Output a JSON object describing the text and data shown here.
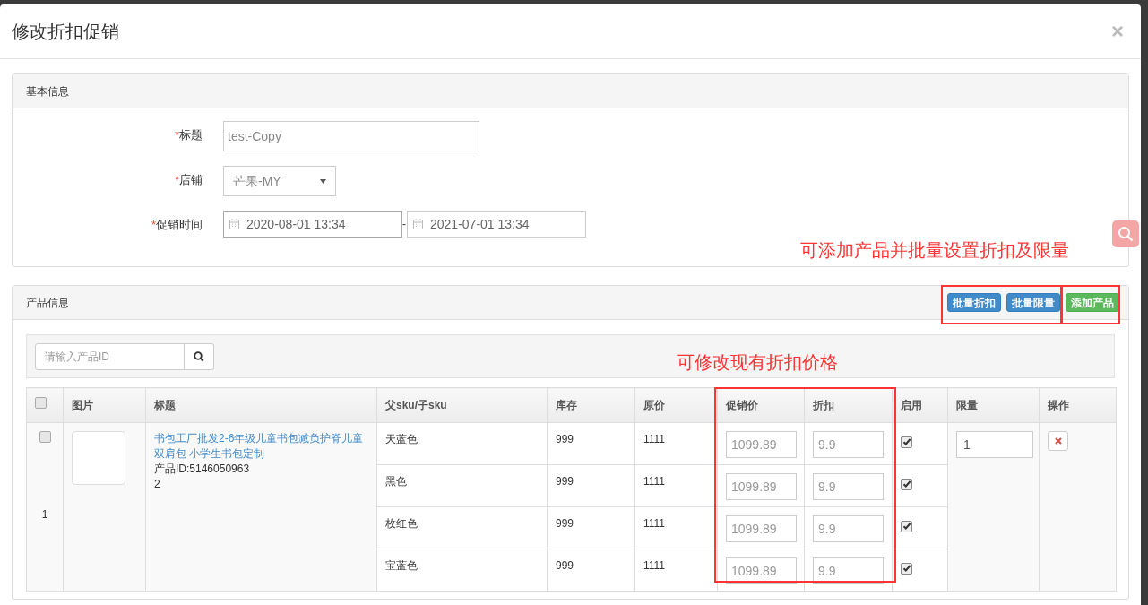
{
  "dialog": {
    "title": "修改折扣促销",
    "close": "×"
  },
  "basic_info": {
    "heading": "基本信息",
    "fields": [
      {
        "kind": "text",
        "required_mark": "*",
        "label": "标题",
        "value": "test-Copy"
      },
      {
        "kind": "select",
        "required_mark": "*",
        "label": "店铺",
        "value": "芒果-MY"
      },
      {
        "kind": "daterange",
        "required_mark": "*",
        "label": "促销时间",
        "start": "2020-08-01 13:34",
        "separator": "-",
        "end": "2021-07-01 13:34"
      }
    ]
  },
  "annotations": [
    "可添加产品并批量设置折扣及限量",
    "可修改现有折扣价格"
  ],
  "product_info": {
    "heading": "产品信息",
    "buttons": [
      {
        "label": "批量折扣",
        "kind": "primary"
      },
      {
        "label": "批量限量",
        "kind": "primary"
      },
      {
        "label": "添加产品",
        "kind": "success"
      }
    ],
    "search": {
      "placeholder": "请输入产品ID"
    },
    "table": {
      "select_all": {
        "checked": false
      },
      "columns": [
        "图片",
        "标题",
        "父sku/子sku",
        "库存",
        "原价",
        "促销价",
        "折扣",
        "启用",
        "限量",
        "操作"
      ],
      "rows": [
        {
          "index": "1",
          "checked": false,
          "title": "书包工厂批发2-6年级儿童书包减负护脊儿童双肩包 小学生书包定制",
          "product_id": "产品ID:5146050963",
          "note": "2",
          "limit": "1",
          "variants": [
            {
              "sku": "天蓝色",
              "stock": "999",
              "price": "1111",
              "promo_price": "1099.89",
              "discount": "9.9",
              "enabled": true
            },
            {
              "sku": "黑色",
              "stock": "999",
              "price": "1111",
              "promo_price": "1099.89",
              "discount": "9.9",
              "enabled": true
            },
            {
              "sku": "枚红色",
              "stock": "999",
              "price": "1111",
              "promo_price": "1099.89",
              "discount": "9.9",
              "enabled": true
            },
            {
              "sku": "宝蓝色",
              "stock": "999",
              "price": "1111",
              "promo_price": "1099.89",
              "discount": "9.9",
              "enabled": true
            }
          ]
        }
      ]
    }
  }
}
